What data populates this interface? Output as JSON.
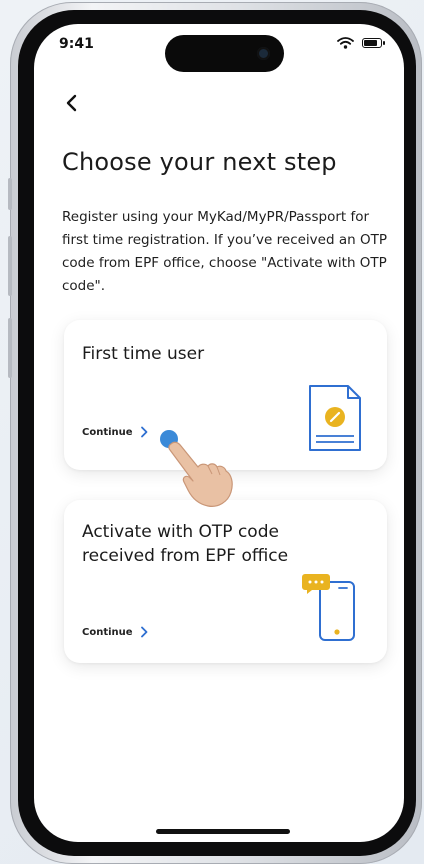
{
  "status_bar": {
    "time": "9:41"
  },
  "header": {
    "back_icon": "chevron-left-icon"
  },
  "page": {
    "title": "Choose your next step",
    "description": "Register using your MyKad/MyPR/Passport for first time registration. If you’ve received an OTP code from EPF office, choose \"Activate with OTP code\"."
  },
  "options": [
    {
      "title": "First time user",
      "link_label": "Continue",
      "icon": "id-document-icon"
    },
    {
      "title": "Activate with OTP code received from EPF office",
      "link_label": "Continue",
      "icon": "phone-otp-icon"
    }
  ],
  "colors": {
    "accent_blue": "#2f6fd1",
    "accent_gold": "#e9b320",
    "tap_indicator": "#3b8ad8"
  }
}
